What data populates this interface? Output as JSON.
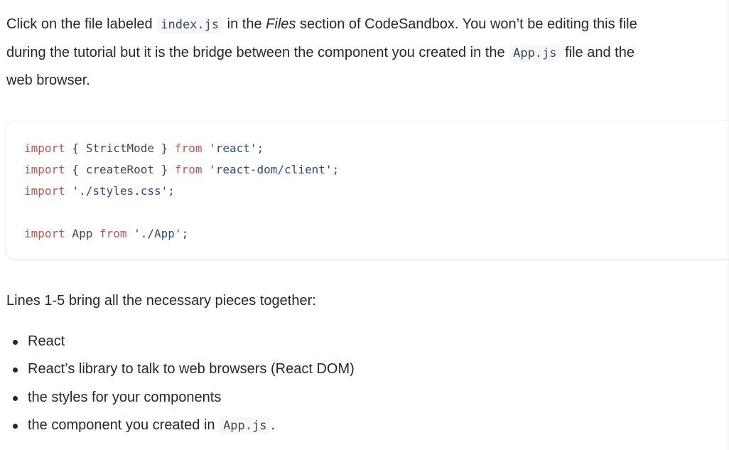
{
  "intro": {
    "part1": "Click on the file labeled ",
    "code1": "index.js",
    "part2": " in the ",
    "files_em": "Files",
    "part3": " section of CodeSandbox. You won’t be editing this file",
    "line2_part1": "during the tutorial but it is the bridge between the component you created in the ",
    "code2": "App.js",
    "line2_part2": " file and the",
    "line3": "web browser."
  },
  "code_block": {
    "lines": [
      [
        {
          "cls": "kw",
          "text": "import"
        },
        {
          "cls": "plain",
          "text": " { StrictMode } "
        },
        {
          "cls": "kw",
          "text": "from"
        },
        {
          "cls": "plain",
          "text": " "
        },
        {
          "cls": "str",
          "text": "'react'"
        },
        {
          "cls": "plain",
          "text": ";"
        }
      ],
      [
        {
          "cls": "kw",
          "text": "import"
        },
        {
          "cls": "plain",
          "text": " { createRoot } "
        },
        {
          "cls": "kw",
          "text": "from"
        },
        {
          "cls": "plain",
          "text": " "
        },
        {
          "cls": "str",
          "text": "'react-dom/client'"
        },
        {
          "cls": "plain",
          "text": ";"
        }
      ],
      [
        {
          "cls": "kw",
          "text": "import"
        },
        {
          "cls": "plain",
          "text": " "
        },
        {
          "cls": "str",
          "text": "'./styles.css'"
        },
        {
          "cls": "plain",
          "text": ";"
        }
      ],
      [],
      [
        {
          "cls": "kw",
          "text": "import"
        },
        {
          "cls": "plain",
          "text": " App "
        },
        {
          "cls": "kw",
          "text": "from"
        },
        {
          "cls": "plain",
          "text": " "
        },
        {
          "cls": "str",
          "text": "'./App'"
        },
        {
          "cls": "plain",
          "text": ";"
        }
      ]
    ]
  },
  "lines_para": "Lines 1-5 bring all the necessary pieces together:",
  "bullets": {
    "item1": "React",
    "item2": "React’s library to talk to web browsers (React DOM)",
    "item3": "the styles for your components",
    "item4_text": "the component you created in ",
    "item4_code": "App.js",
    "item4_end": "."
  },
  "colors": {
    "text": "#23272f",
    "keyword": "#c1554d",
    "string": "#2f4b7c",
    "inline_code_bg": "#f6f7f9"
  }
}
